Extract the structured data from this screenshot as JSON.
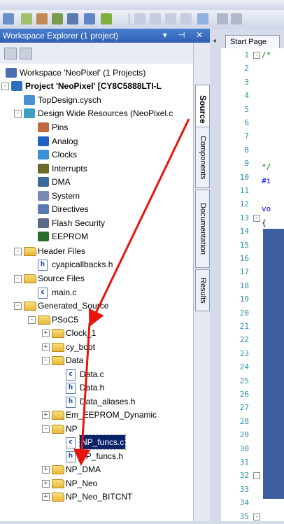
{
  "window": {
    "title": "Workspace Explorer (1 project)",
    "header_icons": "▾ ⊣ ✕"
  },
  "tree": [
    {
      "label": "Workspace 'NeoPixel' (1 Projects)",
      "bold": false,
      "icon": "workspace-icon"
    },
    {
      "label": "Project  'NeoPixel' [CY8C5888LTI-L",
      "bold": true,
      "icon": "project-icon"
    },
    {
      "label": "TopDesign.cysch",
      "icon": "schematic-icon"
    },
    {
      "label": "Design Wide Resources (NeoPixel.c",
      "icon": "dwr-icon"
    },
    {
      "label": "Pins",
      "icon": "pins-icon"
    },
    {
      "label": "Analog",
      "icon": "analog-icon"
    },
    {
      "label": "Clocks",
      "icon": "clocks-icon"
    },
    {
      "label": "Interrupts",
      "icon": "interrupts-icon"
    },
    {
      "label": "DMA",
      "icon": "dma-icon"
    },
    {
      "label": "System",
      "icon": "system-icon"
    },
    {
      "label": "Directives",
      "icon": "directives-icon"
    },
    {
      "label": "Flash Security",
      "icon": "flash-icon"
    },
    {
      "label": "EEPROM",
      "icon": "eeprom-icon"
    },
    {
      "label": "Header Files",
      "icon": "folder-icon"
    },
    {
      "label": "cyapicallbacks.h",
      "icon": "h-file-icon"
    },
    {
      "label": "Source Files",
      "icon": "folder-icon"
    },
    {
      "label": "main.c",
      "icon": "c-file-icon"
    },
    {
      "label": "Generated_Source",
      "icon": "folder-icon"
    },
    {
      "label": "PSoC5",
      "icon": "folder-icon"
    },
    {
      "label": "Clock_1",
      "icon": "folder-icon"
    },
    {
      "label": "cy_boot",
      "icon": "folder-icon"
    },
    {
      "label": "Data",
      "icon": "folder-icon"
    },
    {
      "label": "Data.c",
      "icon": "c-file-icon"
    },
    {
      "label": "Data.h",
      "icon": "h-file-icon"
    },
    {
      "label": "Data_aliases.h",
      "icon": "h-file-icon"
    },
    {
      "label": "Em_EEPROM_Dynamic",
      "icon": "folder-icon"
    },
    {
      "label": "NP",
      "icon": "folder-icon"
    },
    {
      "label": "NP_funcs.c",
      "icon": "c-file-icon"
    },
    {
      "label": "NP_funcs.h",
      "icon": "h-file-icon"
    },
    {
      "label": "NP_DMA",
      "icon": "folder-icon"
    },
    {
      "label": "NP_Neo",
      "icon": "folder-icon"
    },
    {
      "label": "NP_Neo_BITCNT",
      "icon": "folder-icon"
    }
  ],
  "side_tabs": {
    "source": "Source",
    "components": "Components",
    "documentation": "Documentation",
    "results": "Results"
  },
  "editor": {
    "tab": "Start Page",
    "line_numbers": [
      "1",
      "2",
      "3",
      "4",
      "5",
      "6",
      "7",
      "8",
      "9",
      "10",
      "11",
      "12",
      "13",
      "14",
      "15",
      "16",
      "17",
      "18",
      "19",
      "20",
      "21",
      "22",
      "23",
      "24",
      "25",
      "26",
      "27",
      "28",
      "29",
      "30",
      "31",
      "32",
      "33",
      "34",
      "35"
    ],
    "code_fragments": {
      "l1": "/*",
      "l9": "*/",
      "l10": "#i",
      "l12": "vo",
      "l13": "{"
    }
  },
  "colors": {
    "header": "#2f5fb3",
    "arrow": "#e8140c",
    "selection": "#0a246a"
  }
}
